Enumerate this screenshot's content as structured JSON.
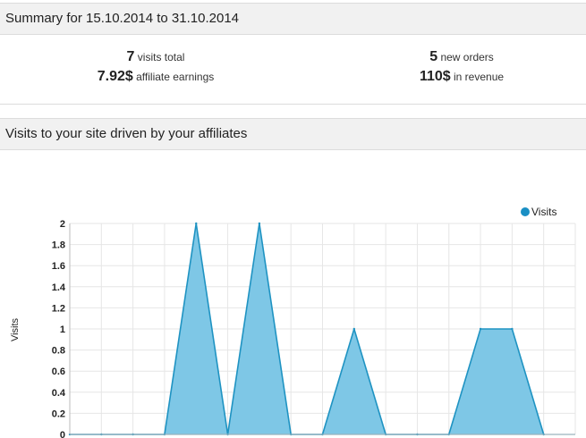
{
  "summary": {
    "title": "Summary for 15.10.2014 to 31.10.2014",
    "visits_value": "7",
    "visits_label": "visits total",
    "earnings_value": "7.92$",
    "earnings_label": "affiliate earnings",
    "orders_value": "5",
    "orders_label": "new orders",
    "revenue_value": "110$",
    "revenue_label": "in revenue"
  },
  "chart_section": {
    "title": "Visits to your site driven by your affiliates"
  },
  "colors": {
    "series_fill": "#7ec7e6",
    "series_stroke": "#1f93c2",
    "legend_dot": "#1a8fc4",
    "grid": "#e6e6e6"
  },
  "chart_data": {
    "type": "area",
    "ylabel": "Visits",
    "xlabel": "",
    "ylim": [
      0,
      2
    ],
    "yticks": [
      "0",
      "0.2",
      "0.4",
      "0.6",
      "0.8",
      "1",
      "1.2",
      "1.4",
      "1.6",
      "1.8",
      "2"
    ],
    "x": [
      0,
      1,
      2,
      3,
      4,
      5,
      6,
      7,
      8,
      9,
      10,
      11,
      12,
      13,
      14,
      15,
      16
    ],
    "series": [
      {
        "name": "Visits",
        "values": [
          0,
          0,
          0,
          0,
          2,
          0,
          2,
          0,
          0,
          1,
          0,
          0,
          0,
          1,
          1,
          0,
          null
        ]
      }
    ],
    "legend": "top-right",
    "grid": true
  }
}
